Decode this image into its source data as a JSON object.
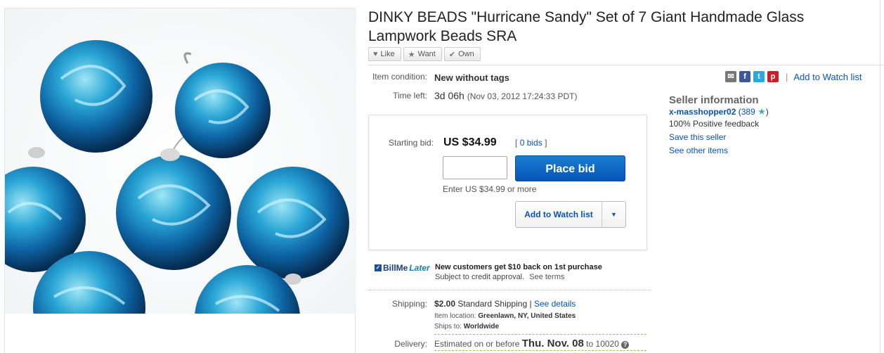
{
  "listing": {
    "title": "DINKY BEADS \"Hurricane Sandy\" Set of 7 Giant Handmade Glass Lampwork Beads SRA"
  },
  "social": {
    "like": "Like",
    "want": "Want",
    "own": "Own"
  },
  "item": {
    "condition_label": "Item condition:",
    "condition_value": "New without tags",
    "time_left_label": "Time left:",
    "time_left_value": "3d 06h",
    "time_left_date": "(Nov 03, 2012  17:24:33 PDT)"
  },
  "share": {
    "add_to_watch": "Add to Watch list",
    "separator": "|",
    "email_glyph": "✉",
    "facebook_glyph": "f",
    "twitter_glyph": "t",
    "pinterest_glyph": "p"
  },
  "bid": {
    "starting_label": "Starting bid:",
    "starting_value": "US $34.99",
    "bids_open": "[",
    "bids_link": "0 bids",
    "bids_close": "]",
    "input_value": "",
    "place_bid": "Place bid",
    "enter_hint": "Enter US $34.99 or more",
    "watch_button": "Add to Watch list",
    "dropdown_glyph": "▼"
  },
  "billmelater": {
    "logo_bill": "BillMe",
    "logo_later": "Later",
    "headline": "New customers get $10 back on 1st purchase",
    "subtext": "Subject to credit approval.",
    "see_terms": "See terms"
  },
  "shipping": {
    "label": "Shipping:",
    "cost": "$2.00",
    "method": "Standard Shipping",
    "sep": "|",
    "details_link": "See details",
    "location_label": "Item location:",
    "location_value": "Greenlawn, NY, United States",
    "ships_to_label": "Ships to:",
    "ships_to_value": "Worldwide"
  },
  "delivery": {
    "label": "Delivery:",
    "prefix": "Estimated on or before",
    "date": "Thu. Nov. 08",
    "suffix": "to 10020",
    "help_glyph": "?"
  },
  "seller": {
    "heading": "Seller information",
    "name": "x-masshopper02",
    "feedback_open": "(",
    "feedback_score": "389",
    "star": "★",
    "feedback_close": ")",
    "positive": "100% Positive feedback",
    "save": "Save this seller",
    "other_items": "See other items"
  },
  "colors": {
    "link": "#0654ba",
    "primary_button": "#0654ba",
    "facebook": "#3b5998",
    "twitter": "#2aa9e0",
    "pinterest": "#cb2027"
  }
}
